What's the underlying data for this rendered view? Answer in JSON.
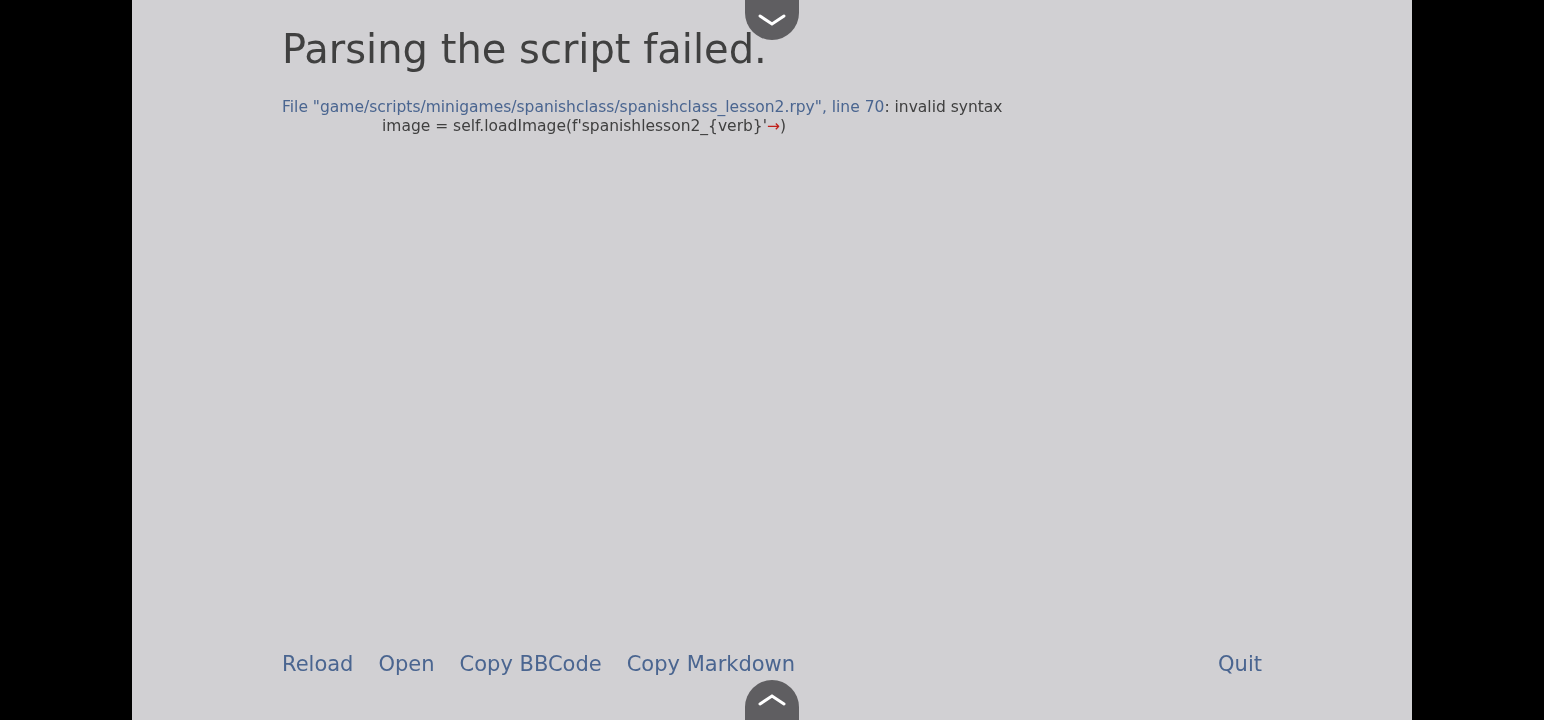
{
  "title": "Parsing the script failed.",
  "error": {
    "location": "File \"game/scripts/minigames/spanishclass/spanishclass_lesson2.rpy\", line 70",
    "message": ": invalid syntax",
    "code": "image = self.loadImage(f'spanishlesson2_{verb}'",
    "marker": "→",
    "code_end": ")"
  },
  "actions": [
    {
      "label": "Reload"
    },
    {
      "label": "Open"
    },
    {
      "label": "Copy BBCode"
    },
    {
      "label": "Copy Markdown"
    }
  ],
  "quit": {
    "label": "Quit"
  }
}
